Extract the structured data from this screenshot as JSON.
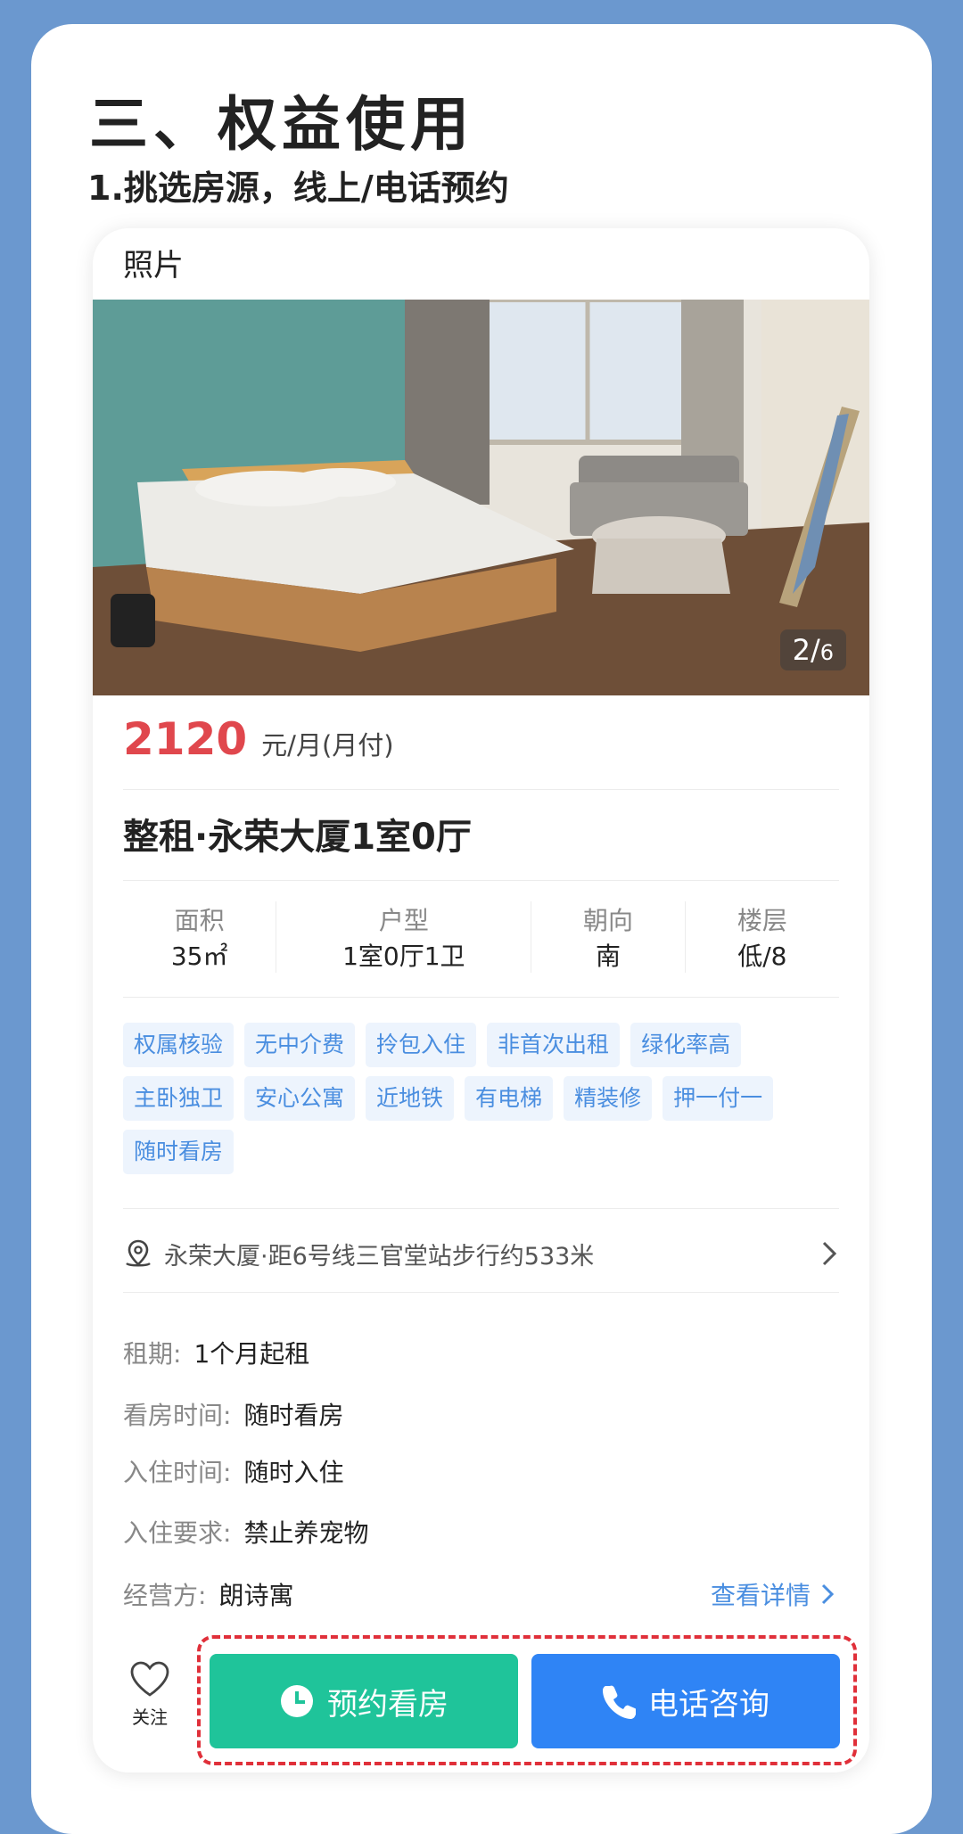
{
  "section": {
    "heading": "三、权益使用",
    "subheading": "1.挑选房源，线上/电话预约"
  },
  "listing": {
    "photo_tab": "照片",
    "photo_counter": {
      "current": "2/",
      "total": "6"
    },
    "price": "2120",
    "price_unit": "元/月(月付)",
    "title": "整租·永荣大厦1室0厅",
    "specs": [
      {
        "key": "面积",
        "value": "35㎡"
      },
      {
        "key": "户型",
        "value": "1室0厅1卫"
      },
      {
        "key": "朝向",
        "value": "南"
      },
      {
        "key": "楼层",
        "value": "低/8"
      }
    ],
    "tags": [
      [
        "权属核验",
        "无中介费",
        "拎包入住",
        "非首次出租",
        "绿化率高"
      ],
      [
        "主卧独卫",
        "安心公寓",
        "近地铁",
        "有电梯",
        "精装修",
        "押一付一"
      ],
      [
        "随时看房"
      ]
    ],
    "address": "永荣大厦·距6号线三官堂站步行约533米",
    "info": [
      {
        "key": "租期:",
        "value": "1个月起租"
      },
      {
        "key": "看房时间:",
        "value": "随时看房"
      },
      {
        "key": "入住时间:",
        "value": "随时入住"
      },
      {
        "key": "入住要求:",
        "value": "禁止养宠物"
      },
      {
        "key": "经营方:",
        "value": "朗诗寓"
      }
    ],
    "detail_link": "查看详情",
    "favorite_label": "关注",
    "book_button": "预约看房",
    "call_button": "电话咨询"
  },
  "colors": {
    "background": "#6b98cf",
    "price": "#e0474d",
    "tag_text": "#4a8ee0",
    "book": "#1fc49a",
    "call": "#2f84f5",
    "highlight_border": "#e0303a"
  }
}
